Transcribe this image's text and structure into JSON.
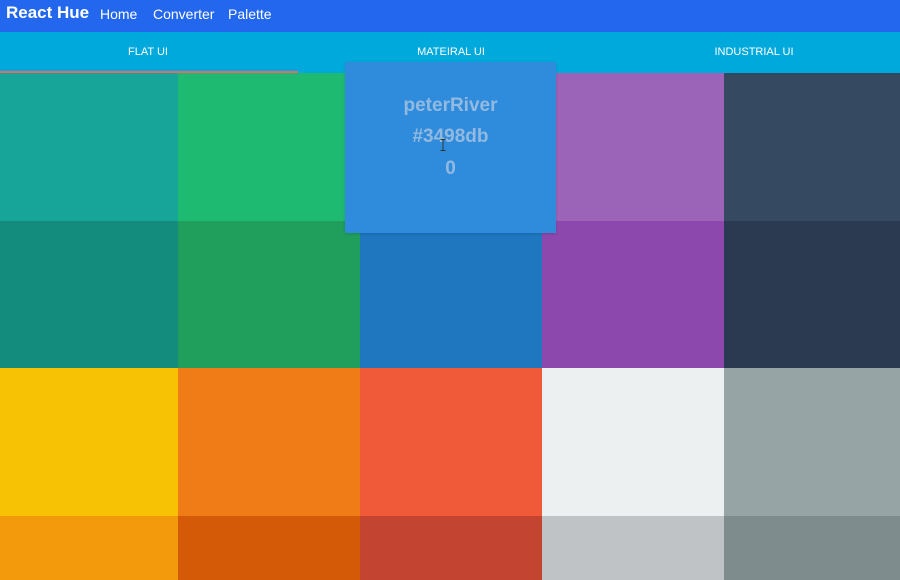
{
  "navbar": {
    "brand": "React Hue",
    "links": [
      "Home",
      "Converter",
      "Palette"
    ]
  },
  "tabs": [
    {
      "label": "FLAT UI",
      "active": true
    },
    {
      "label": "MATEIRAL UI",
      "active": false
    },
    {
      "label": "INDUSTRIAL UI",
      "active": false
    }
  ],
  "colors": {
    "navbar": "#2367ef",
    "tabs": "#00a9dc",
    "indicator": "#e56b6b"
  },
  "swatches": [
    "#17a59a",
    "#1fba71",
    "#2f8cdc",
    "#9c64b8",
    "#354a60",
    "#138c7e",
    "#1f9f5b",
    "#1f78bf",
    "#8c48ad",
    "#2b3a50",
    "#f7c203",
    "#f07c18",
    "#f05a38",
    "#ecf0f1",
    "#97a4a5",
    "#f39a0c",
    "#d45a07",
    "#c44432",
    "#bfc3c6",
    "#7e8c8d"
  ],
  "popup": {
    "name": "peterRiver",
    "hex": "#3498db",
    "index": "0"
  }
}
